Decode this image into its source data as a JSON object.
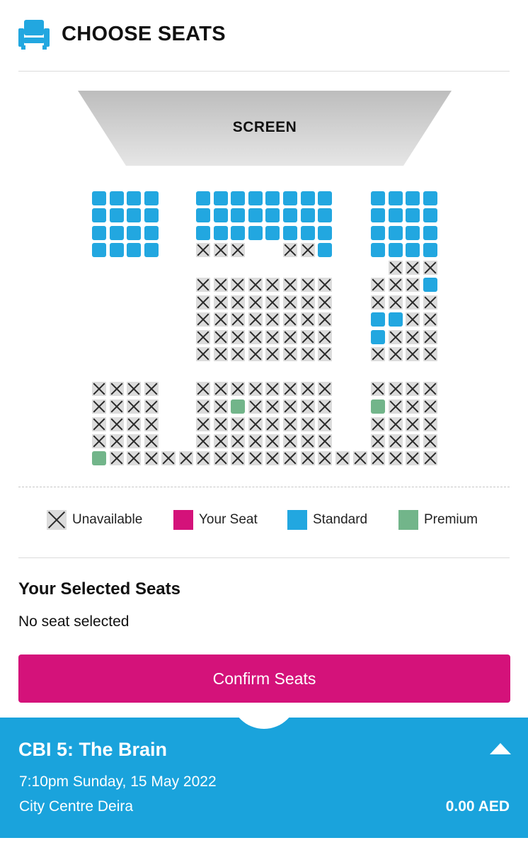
{
  "header": {
    "icon": "seat-icon",
    "title": "CHOOSE SEATS"
  },
  "screen": {
    "label": "SCREEN"
  },
  "colors": {
    "standard": "#22a7e0",
    "premium": "#72b58a",
    "your_seat": "#d4127a",
    "unavailable": "#dcdcdc",
    "footer": "#1aa3dc"
  },
  "seat_map": {
    "legend": {
      "S": "standard",
      "P": "premium",
      "X": "unavailable",
      ".": "no seat"
    },
    "sections": [
      {
        "name": "left",
        "rows": [
          "SSSS",
          "SSSS",
          "SSSS",
          "SSSS",
          "....",
          "....",
          "....",
          "....",
          "....",
          "....",
          "....",
          "XXXX",
          "XXXX",
          "XXXX",
          "XXXX",
          "PXXX"
        ]
      },
      {
        "name": "bridge-left",
        "rows": [
          "XX"
        ]
      },
      {
        "name": "center",
        "rows": [
          "SSSSSSSS",
          "SSSSSSSS",
          "SSSSSSSS",
          "XXX..XXS",
          "........",
          "XXXXXXXX",
          "XXXXXXXX",
          "XXXXXXXX",
          "XXXXXXXX",
          "XXXXXXXX",
          "........",
          "XXXXXXXX",
          "XXPXXXXX",
          "XXXXXXXX",
          "XXXXXXXX",
          "XXXXXXXX"
        ]
      },
      {
        "name": "bridge-right",
        "rows": [
          "XX"
        ]
      },
      {
        "name": "right",
        "rows": [
          "SSSS",
          "SSSS",
          "SSSS",
          "SSSS",
          ".XXX",
          "XXXS",
          "XXXX",
          "SSXX",
          "SXXX",
          "XXXX",
          "....",
          "XXXX",
          "PXXX",
          "XXXX",
          "XXXX",
          "XXXX"
        ]
      }
    ]
  },
  "legend": [
    {
      "key": "unavailable",
      "label": "Unavailable"
    },
    {
      "key": "your_seat",
      "label": "Your Seat"
    },
    {
      "key": "standard",
      "label": "Standard"
    },
    {
      "key": "premium",
      "label": "Premium"
    }
  ],
  "selected": {
    "title": "Your Selected Seats",
    "text": "No seat selected"
  },
  "confirm_label": "Confirm Seats",
  "footer": {
    "movie": "CBI 5: The Brain",
    "showtime": "7:10pm Sunday, 15 May 2022",
    "cinema": "City Centre Deira",
    "price": "0.00 AED",
    "toggle_icon": "caret-up-icon"
  }
}
